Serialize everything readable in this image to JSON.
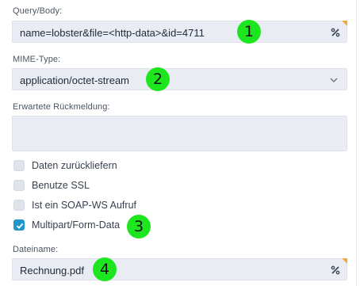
{
  "query": {
    "label": "Query/Body:",
    "value": "name=lobster&file=<http-data>&id=4711"
  },
  "mime": {
    "label": "MIME-Type:",
    "value": "application/octet-stream"
  },
  "response": {
    "label": "Erwartete Rückmeldung:",
    "value": ""
  },
  "options": [
    {
      "label": "Daten zurückliefern",
      "checked": false
    },
    {
      "label": "Benutze SSL",
      "checked": false
    },
    {
      "label": "Ist ein SOAP-WS Aufruf",
      "checked": false
    },
    {
      "label": "Multipart/Form-Data",
      "checked": true
    }
  ],
  "filename": {
    "label": "Dateiname:",
    "value": "Rechnung.pdf"
  },
  "badges": [
    "1",
    "2",
    "3",
    "4"
  ],
  "colors": {
    "badge": "#1ee61e",
    "checked": "#2196c9",
    "corner_marker": "#f2a73b",
    "field_bg": "#e9edf3"
  }
}
